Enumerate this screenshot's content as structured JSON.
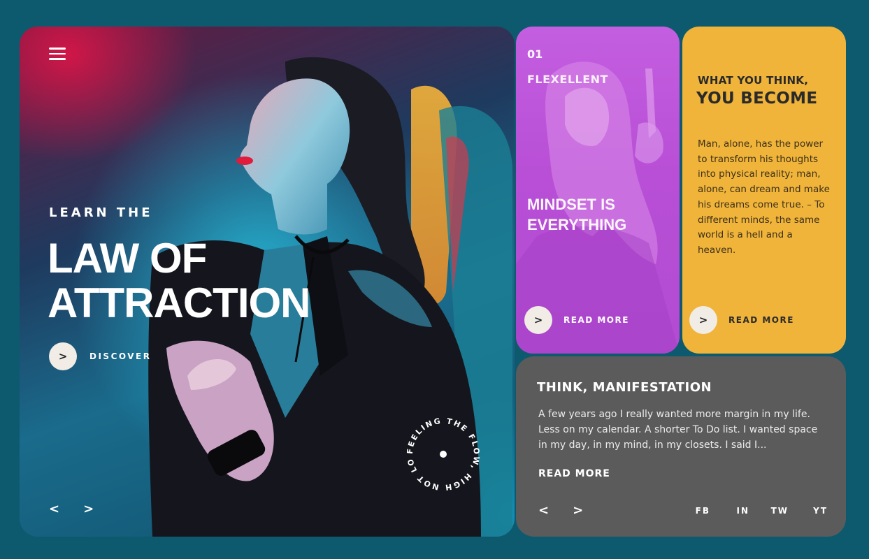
{
  "hero": {
    "kicker": "LEARN THE",
    "title_line1": "LAW OF",
    "title_line2": "ATTRACTION",
    "discover_label": "DISCOVER",
    "arrow_glyph": ">",
    "prev_glyph": "<",
    "next_glyph": ">",
    "badge_text": "FEELING THE FLOW, HIGH NOT LOW"
  },
  "purple_card": {
    "number": "01",
    "brand": "FLEXELLENT",
    "headline_line1": "MINDSET IS",
    "headline_line2": "EVERYTHING",
    "cta_label": "READ MORE",
    "arrow_glyph": ">"
  },
  "yellow_card": {
    "kicker": "WHAT YOU THINK,",
    "headline": "YOU BECOME",
    "body": "Man, alone, has the power to transform his thoughts into physical reality; man, alone, can dream and make his dreams come true. – To different minds, the same world is a hell and a heaven.",
    "cta_label": "READ MORE",
    "arrow_glyph": ">"
  },
  "gray_card": {
    "title": "THINK, MANIFESTATION",
    "body": "A few years ago I really wanted more margin in my life. Less on my calendar. A shorter To Do list. I wanted space in my day, in my mind, in my closets. I said I...",
    "read_more": "READ MORE",
    "prev_glyph": "<",
    "next_glyph": ">",
    "social": [
      "FB",
      "IN",
      "TW",
      "YT"
    ]
  },
  "colors": {
    "page_bg": "#0d5a6f",
    "purple": "#b84fd6",
    "yellow": "#f0b43a",
    "gray": "#5b5b5b"
  },
  "icons": [
    "menu-icon",
    "arrow-right-icon",
    "chevron-left-icon",
    "chevron-right-icon"
  ]
}
